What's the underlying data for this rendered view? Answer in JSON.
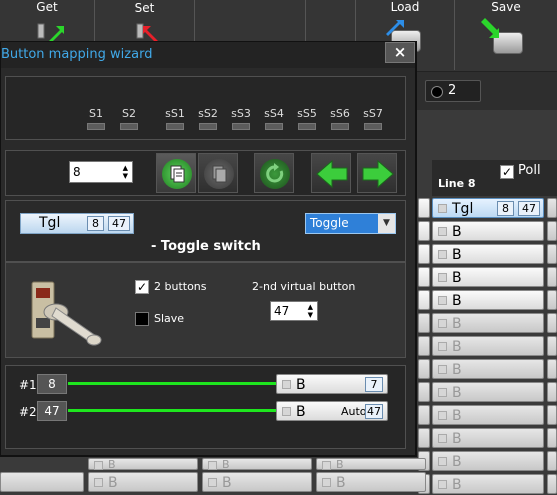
{
  "toolbar": {
    "get_label": "Get",
    "set_label": "Set",
    "load_label": "Load",
    "save_label": "Save"
  },
  "background": {
    "badge_value": "2",
    "column_header": "Line 8",
    "poll_label": "Poll",
    "rows": [
      {
        "label": "Tgl",
        "num1": "8",
        "num2": "47",
        "selected": true
      },
      {
        "label": "B"
      },
      {
        "label": "B"
      },
      {
        "label": "B"
      },
      {
        "label": "B"
      },
      {
        "label": "B"
      },
      {
        "label": "B"
      },
      {
        "label": "B"
      },
      {
        "label": "B"
      },
      {
        "label": "B"
      },
      {
        "label": "B"
      },
      {
        "label": "B"
      },
      {
        "label": "B"
      }
    ],
    "bottom_cell_label": "B"
  },
  "dialog": {
    "title": "Button mapping wizard",
    "close_label": "×",
    "switch_labels": [
      "S1",
      "S2",
      "sS1",
      "sS2",
      "sS3",
      "sS4",
      "sS5",
      "sS6",
      "sS7"
    ],
    "button_number": "8",
    "binding": {
      "label": "Tgl",
      "num1": "8",
      "num2": "47"
    },
    "type_select": "Toggle",
    "type_title": "- Toggle switch",
    "two_buttons_label": "2 buttons",
    "two_buttons_checked": true,
    "slave_label": "Slave",
    "slave_checked": false,
    "virtual_button_label": "2-nd virtual button",
    "virtual_button_value": "47",
    "mappings": [
      {
        "id": "#1",
        "src": "8",
        "target_label": "B",
        "target_extra": "",
        "target_num": "7"
      },
      {
        "id": "#2",
        "src": "47",
        "target_label": "B",
        "target_extra": "Auto",
        "target_num": "47"
      }
    ]
  },
  "colors": {
    "accent": "#41a9e8",
    "map_line": "#1ee61e",
    "dropdown": "#2f80d8"
  }
}
